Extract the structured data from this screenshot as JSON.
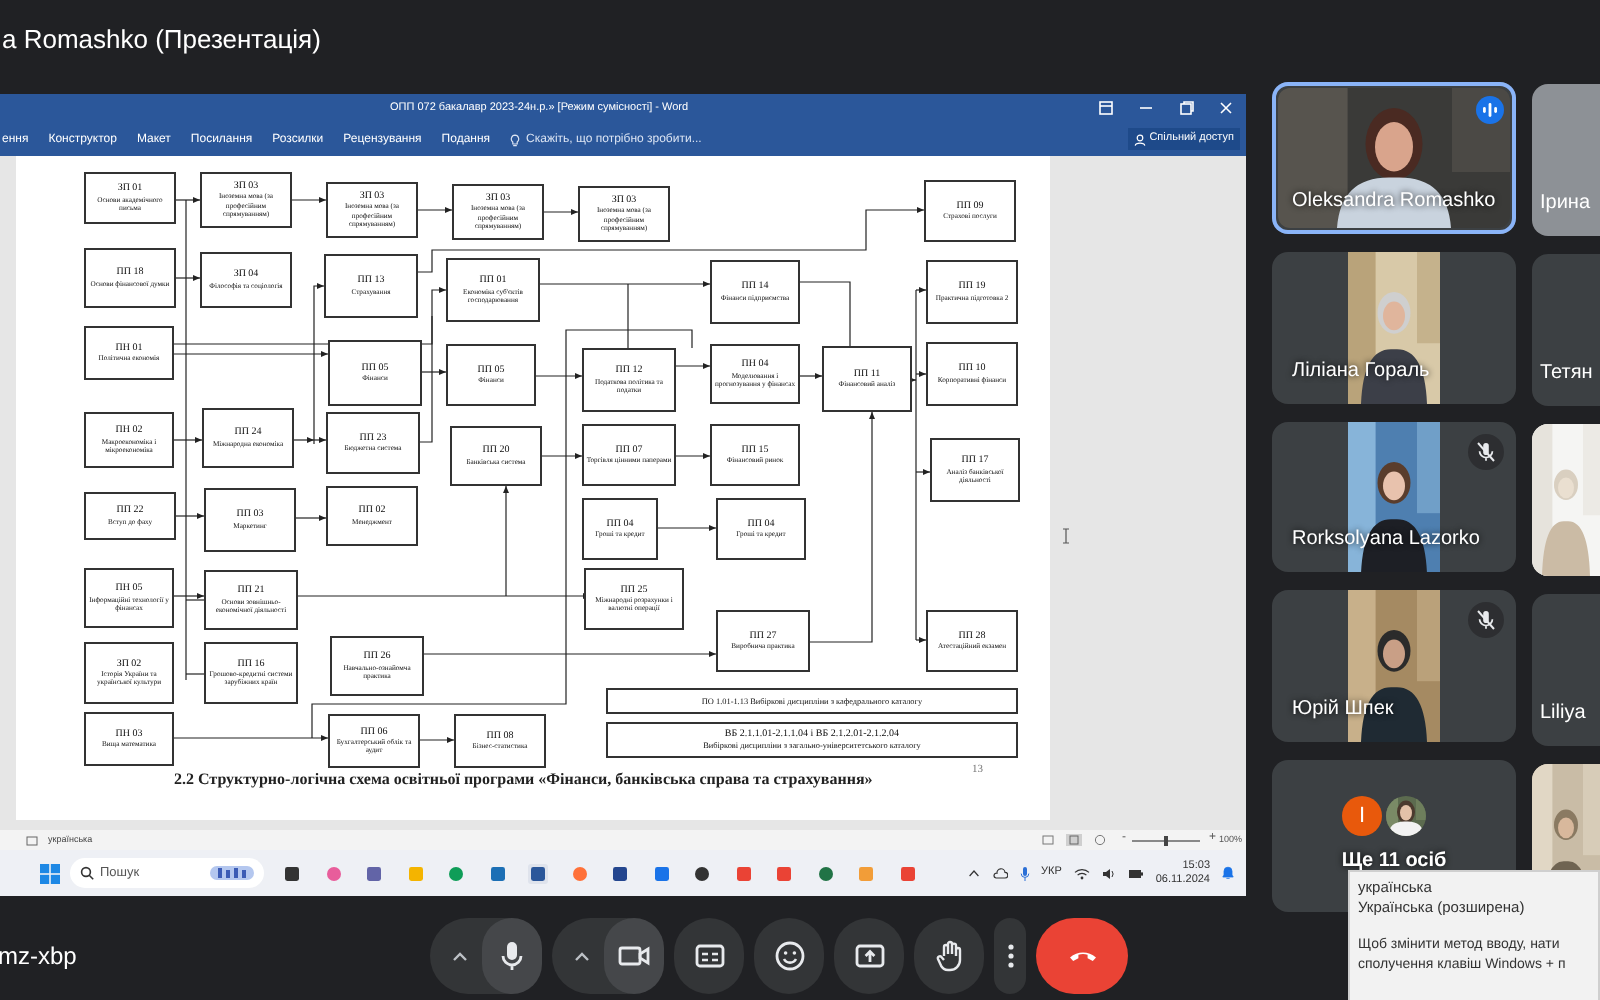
{
  "meeting": {
    "title": "a Romashko (Презентація)",
    "code": "mz-xbp"
  },
  "word": {
    "title": "ОПП 072 бакалавр 2023-24н.р.» [Режим сумісності] - Word",
    "ribbon_tabs": [
      "ення",
      "Конструктор",
      "Макет",
      "Посилання",
      "Розсилки",
      "Рецензування",
      "Подання"
    ],
    "tell_me": "Скажіть, що потрібно зробити...",
    "share": "Спільний доступ",
    "nodes": [
      {
        "code": "ЗП 01",
        "name": "Основи академічного письма"
      },
      {
        "code": "ЗП 03",
        "name": "Іноземна мова (за професійним спрямуванням)"
      },
      {
        "code": "ЗП 03",
        "name": "Іноземна мова (за професійним спрямуванням)"
      },
      {
        "code": "ЗП 03",
        "name": "Іноземна мова (за професійним спрямуванням)"
      },
      {
        "code": "ЗП 03",
        "name": "Іноземна мова (за професійним спрямуванням)"
      },
      {
        "code": "ПП 09",
        "name": "Страхові послуги"
      },
      {
        "code": "ПП 18",
        "name": "Основи фінансової думки"
      },
      {
        "code": "ЗП 04",
        "name": "Філософія та соціологія"
      },
      {
        "code": "ПП 13",
        "name": "Страхування"
      },
      {
        "code": "ПП 01",
        "name": "Економіка суб'єктів господарювання"
      },
      {
        "code": "ПП 14",
        "name": "Фінанси підприємства"
      },
      {
        "code": "ПП 19",
        "name": "Практична підготовка 2"
      },
      {
        "code": "ПН 01",
        "name": "Політична економія"
      },
      {
        "code": "ПП 05",
        "name": "Фінанси"
      },
      {
        "code": "ПП 05",
        "name": "Фінанси"
      },
      {
        "code": "ПП 12",
        "name": "Податкова політика та податки"
      },
      {
        "code": "ПН 04",
        "name": "Моделювання і прогнозування у фінансах"
      },
      {
        "code": "ПП 11",
        "name": "Фінансовий аналіз"
      },
      {
        "code": "ПП 10",
        "name": "Корпоративні фінанси"
      },
      {
        "code": "ПН 02",
        "name": "Макроекономіка і мікроекономіка"
      },
      {
        "code": "ПП 24",
        "name": "Міжнародна економіка"
      },
      {
        "code": "ПП 23",
        "name": "Бюджетна система"
      },
      {
        "code": "ПП 20",
        "name": "Банківська система"
      },
      {
        "code": "ПП 07",
        "name": "Торгівля цінними паперами"
      },
      {
        "code": "ПП 15",
        "name": "Фінансовий ринок"
      },
      {
        "code": "ПП 17",
        "name": "Аналіз банківської діяльності"
      },
      {
        "code": "ПП 22",
        "name": "Вступ до фаху"
      },
      {
        "code": "ПП 03",
        "name": "Маркетинг"
      },
      {
        "code": "ПП 02",
        "name": "Менеджмент"
      },
      {
        "code": "ПП 04",
        "name": "Гроші та кредит"
      },
      {
        "code": "ПП 04",
        "name": "Гроші та кредит"
      },
      {
        "code": "ПН 05",
        "name": "Інформаційні технології у фінансах"
      },
      {
        "code": "ПП 21",
        "name": "Основи зовнішньо-економічної діяльності"
      },
      {
        "code": "ПП 25",
        "name": "Міжнародні розрахунки і валютні операції"
      },
      {
        "code": "ПП 26",
        "name": "Навчально-ознайомча практика"
      },
      {
        "code": "ЗП 02",
        "name": "Історія України та української культури"
      },
      {
        "code": "ПП 16",
        "name": "Грошово-кредитні системи зарубіжних країн"
      },
      {
        "code": "ПП 27",
        "name": "Виробнича практика"
      },
      {
        "code": "ПП 28",
        "name": "Атестаційний екзамен"
      },
      {
        "code": "ПН 03",
        "name": "Вища математика"
      },
      {
        "code": "ПП 06",
        "name": "Бухгалтерський облік та аудит"
      },
      {
        "code": "ПП 08",
        "name": "Бізнес-статистика"
      }
    ],
    "elective_boxes": [
      {
        "lines": [
          "ПО 1.01-1.13 Вибіркові дисципліни з кафедрального каталогу"
        ]
      },
      {
        "lines": [
          "ВБ 2.1.1.01-2.1.1.04 і ВБ 2.1.2.01-2.1.2.04",
          "Вибіркові дисципліни з загально-університетського каталогу"
        ]
      }
    ],
    "caption": "2.2 Структурно-логічна схема освітньої програми «Фінанси, банківська справа та страхування»",
    "page_number": "13",
    "status_language": "українська",
    "zoom_out": "-",
    "zoom_slider": {
      "level": 0.5
    },
    "zoom_in": "+",
    "zoom": "100%"
  },
  "taskbar": {
    "search_placeholder": "Пошук",
    "language": "УКР",
    "time": "15:03",
    "date": "06.11.2024"
  },
  "participants": [
    {
      "kind": "full",
      "name": "Oleksandra Romashko",
      "speaking": true,
      "muted": false
    },
    {
      "kind": "portrait",
      "name": "Ліліана Гораль",
      "speaking": false,
      "muted": false
    },
    {
      "kind": "portrait",
      "name": "Rorksolyana Lazorko",
      "speaking": false,
      "muted": true
    },
    {
      "kind": "portrait",
      "name": "Юрій Шпек",
      "speaking": false,
      "muted": true
    },
    {
      "kind": "others",
      "name": "Ще 11 осіб",
      "avatar_letter": "І",
      "speaking": false,
      "muted": false
    }
  ],
  "side_tiles": [
    {
      "kind": "video",
      "name": "Ірина"
    },
    {
      "kind": "name",
      "name": "Тетян"
    },
    {
      "kind": "picture"
    },
    {
      "kind": "name",
      "name": "Liliya"
    },
    {
      "kind": "picture"
    }
  ],
  "controls": [
    {
      "kind": "mic"
    },
    {
      "kind": "camera"
    },
    {
      "kind": "captions"
    },
    {
      "kind": "emoji"
    },
    {
      "kind": "present"
    },
    {
      "kind": "hand"
    },
    {
      "kind": "more"
    },
    {
      "kind": "end"
    }
  ],
  "tooltip": {
    "language_lines": [
      "українська",
      "Українська (розширена)"
    ],
    "hint_lines": [
      "Щоб змінити метод вводу, нати",
      "сполучення клавіш Windows + п"
    ]
  }
}
